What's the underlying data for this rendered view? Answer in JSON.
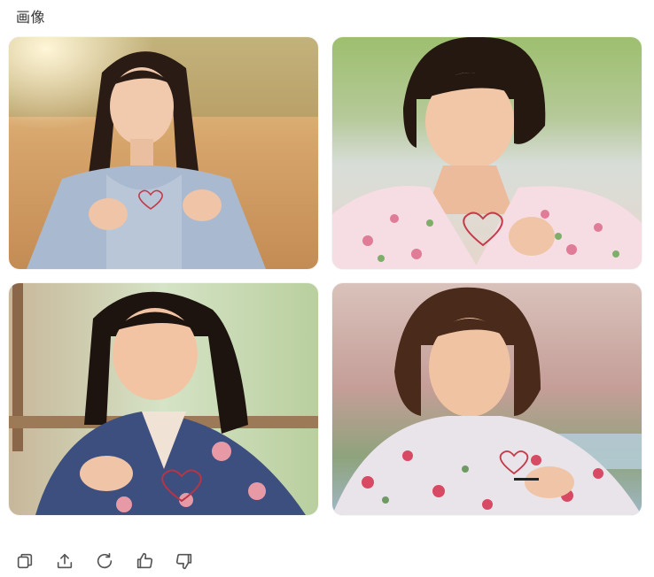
{
  "header": {
    "title": "画像"
  },
  "images": [
    {
      "icon": "portrait-photo-1",
      "watermark": ""
    },
    {
      "icon": "portrait-photo-2",
      "watermark": ""
    },
    {
      "icon": "portrait-photo-3",
      "watermark": ""
    },
    {
      "icon": "portrait-photo-4",
      "watermark": ""
    }
  ],
  "toolbar": {
    "buttons": [
      {
        "icon": "copy-icon"
      },
      {
        "icon": "share-icon"
      },
      {
        "icon": "regenerate-icon"
      },
      {
        "icon": "thumbs-up-icon"
      },
      {
        "icon": "thumbs-down-icon"
      }
    ]
  },
  "colors": {
    "icon": "#555555",
    "title": "#333333"
  }
}
